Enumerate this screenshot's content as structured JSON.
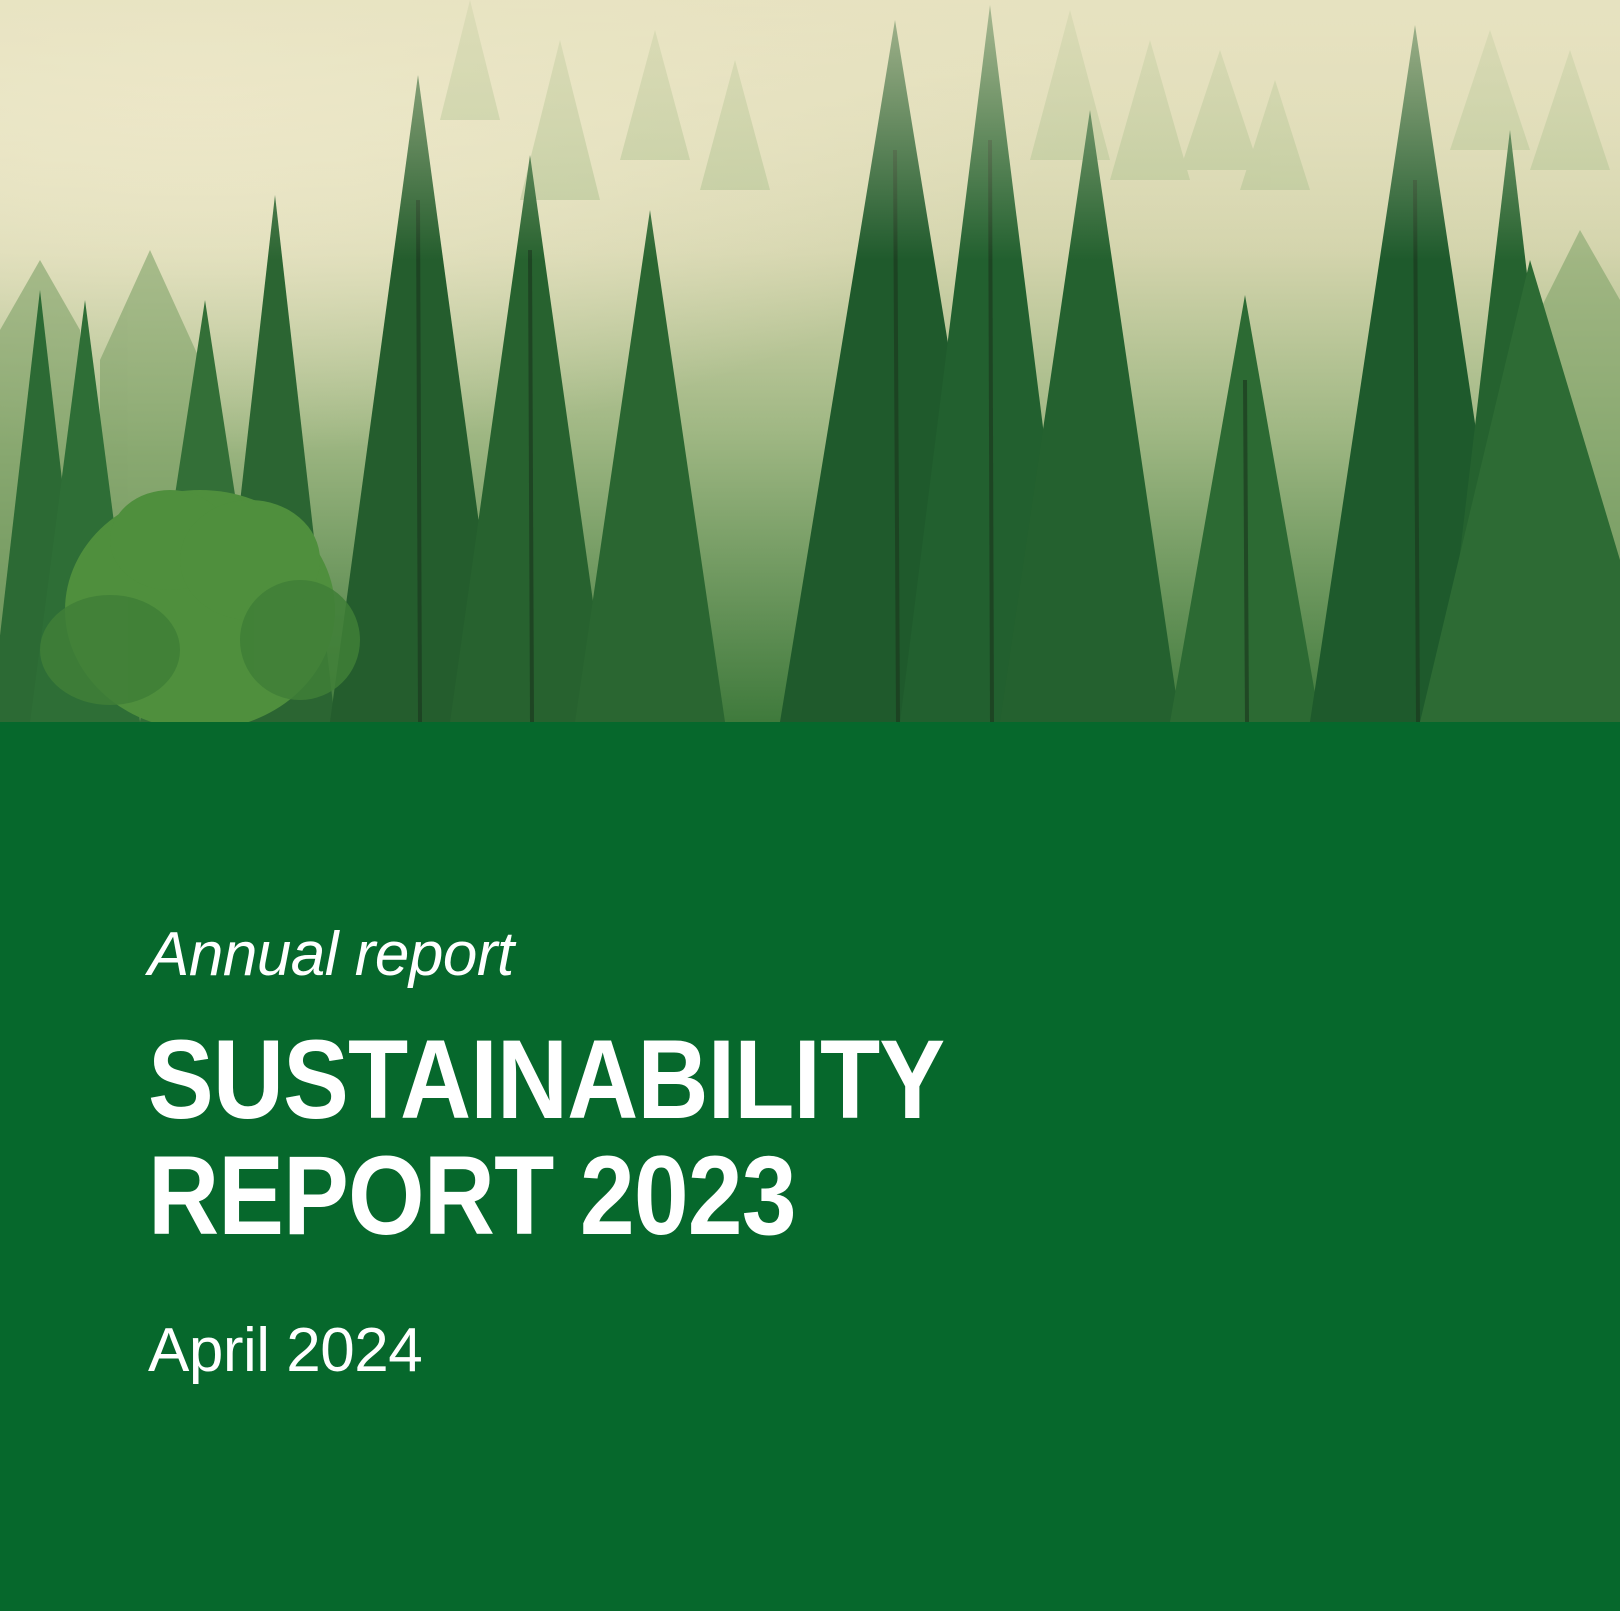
{
  "cover": {
    "subtitle": "Annual report",
    "title_line1": "SUSTAINABILITY",
    "title_line2": "REPORT 2023",
    "date": "April 2024"
  },
  "image": {
    "subject": "forest-photo"
  },
  "colors": {
    "panel": "#06682c",
    "text": "#ffffff",
    "mist": "#e8e3c2",
    "tree_dark": "#1f5a2c",
    "tree_light": "#4f8f3d"
  }
}
